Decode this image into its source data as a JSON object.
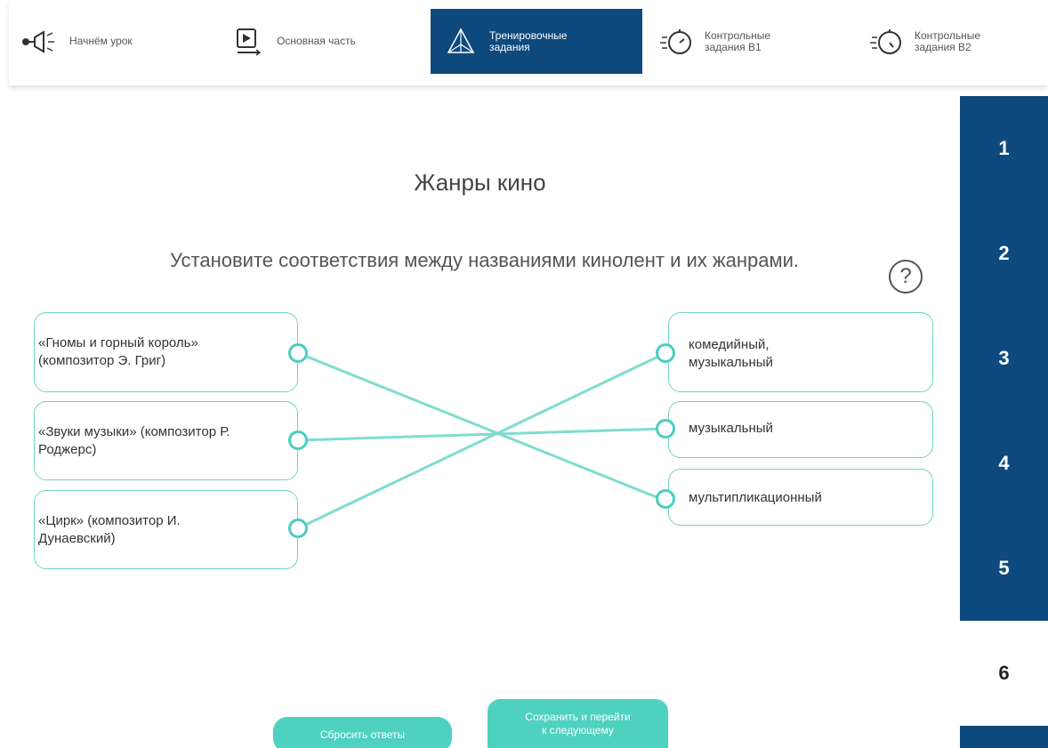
{
  "nav": {
    "items": [
      {
        "label": "Начнём урок",
        "icon": "megaphone-icon",
        "active": false
      },
      {
        "label": "Основная часть",
        "icon": "play-icon",
        "active": false
      },
      {
        "label": "Тренировочные\nзадания",
        "icon": "pyramid-icon",
        "active": true
      },
      {
        "label": "Контрольные\nзадания В1",
        "icon": "stopwatch-icon",
        "active": false
      },
      {
        "label": "Контрольные\nзадания В2",
        "icon": "stopwatch-icon",
        "active": false
      }
    ]
  },
  "sidebar": {
    "numbers": [
      "1",
      "2",
      "3",
      "4",
      "5",
      "6"
    ],
    "current": "6"
  },
  "task": {
    "title": "Жанры кино",
    "instruction": "Установите соответствия между названиями кинолент и их жанрами.",
    "help_symbol": "?",
    "left_items": [
      "«Гномы и горный король» (композитор Э. Григ)",
      "«Звуки музыки» (композитор Р. Роджерс)",
      "«Цирк» (композитор И. Дунаевский)"
    ],
    "right_items": [
      "комедийный, музыкальный",
      "музыкальный",
      "мультипликационный"
    ],
    "matches": [
      [
        0,
        2
      ],
      [
        1,
        1
      ],
      [
        2,
        0
      ]
    ]
  },
  "buttons": {
    "reset": "Сбросить ответы",
    "save_next": "Сохранить и перейти\nк следующему"
  },
  "colors": {
    "accent_dark": "#0e4a7e",
    "accent_teal": "#4fd1c1",
    "line_teal": "#7fdccf"
  }
}
